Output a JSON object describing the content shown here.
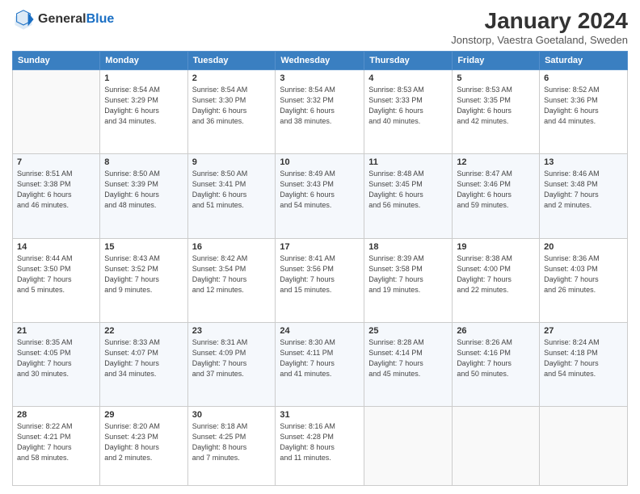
{
  "header": {
    "logo_general": "General",
    "logo_blue": "Blue",
    "month_title": "January 2024",
    "location": "Jonstorp, Vaestra Goetaland, Sweden"
  },
  "weekdays": [
    "Sunday",
    "Monday",
    "Tuesday",
    "Wednesday",
    "Thursday",
    "Friday",
    "Saturday"
  ],
  "weeks": [
    [
      {
        "day": "",
        "info": ""
      },
      {
        "day": "1",
        "info": "Sunrise: 8:54 AM\nSunset: 3:29 PM\nDaylight: 6 hours\nand 34 minutes."
      },
      {
        "day": "2",
        "info": "Sunrise: 8:54 AM\nSunset: 3:30 PM\nDaylight: 6 hours\nand 36 minutes."
      },
      {
        "day": "3",
        "info": "Sunrise: 8:54 AM\nSunset: 3:32 PM\nDaylight: 6 hours\nand 38 minutes."
      },
      {
        "day": "4",
        "info": "Sunrise: 8:53 AM\nSunset: 3:33 PM\nDaylight: 6 hours\nand 40 minutes."
      },
      {
        "day": "5",
        "info": "Sunrise: 8:53 AM\nSunset: 3:35 PM\nDaylight: 6 hours\nand 42 minutes."
      },
      {
        "day": "6",
        "info": "Sunrise: 8:52 AM\nSunset: 3:36 PM\nDaylight: 6 hours\nand 44 minutes."
      }
    ],
    [
      {
        "day": "7",
        "info": "Sunrise: 8:51 AM\nSunset: 3:38 PM\nDaylight: 6 hours\nand 46 minutes."
      },
      {
        "day": "8",
        "info": "Sunrise: 8:50 AM\nSunset: 3:39 PM\nDaylight: 6 hours\nand 48 minutes."
      },
      {
        "day": "9",
        "info": "Sunrise: 8:50 AM\nSunset: 3:41 PM\nDaylight: 6 hours\nand 51 minutes."
      },
      {
        "day": "10",
        "info": "Sunrise: 8:49 AM\nSunset: 3:43 PM\nDaylight: 6 hours\nand 54 minutes."
      },
      {
        "day": "11",
        "info": "Sunrise: 8:48 AM\nSunset: 3:45 PM\nDaylight: 6 hours\nand 56 minutes."
      },
      {
        "day": "12",
        "info": "Sunrise: 8:47 AM\nSunset: 3:46 PM\nDaylight: 6 hours\nand 59 minutes."
      },
      {
        "day": "13",
        "info": "Sunrise: 8:46 AM\nSunset: 3:48 PM\nDaylight: 7 hours\nand 2 minutes."
      }
    ],
    [
      {
        "day": "14",
        "info": "Sunrise: 8:44 AM\nSunset: 3:50 PM\nDaylight: 7 hours\nand 5 minutes."
      },
      {
        "day": "15",
        "info": "Sunrise: 8:43 AM\nSunset: 3:52 PM\nDaylight: 7 hours\nand 9 minutes."
      },
      {
        "day": "16",
        "info": "Sunrise: 8:42 AM\nSunset: 3:54 PM\nDaylight: 7 hours\nand 12 minutes."
      },
      {
        "day": "17",
        "info": "Sunrise: 8:41 AM\nSunset: 3:56 PM\nDaylight: 7 hours\nand 15 minutes."
      },
      {
        "day": "18",
        "info": "Sunrise: 8:39 AM\nSunset: 3:58 PM\nDaylight: 7 hours\nand 19 minutes."
      },
      {
        "day": "19",
        "info": "Sunrise: 8:38 AM\nSunset: 4:00 PM\nDaylight: 7 hours\nand 22 minutes."
      },
      {
        "day": "20",
        "info": "Sunrise: 8:36 AM\nSunset: 4:03 PM\nDaylight: 7 hours\nand 26 minutes."
      }
    ],
    [
      {
        "day": "21",
        "info": "Sunrise: 8:35 AM\nSunset: 4:05 PM\nDaylight: 7 hours\nand 30 minutes."
      },
      {
        "day": "22",
        "info": "Sunrise: 8:33 AM\nSunset: 4:07 PM\nDaylight: 7 hours\nand 34 minutes."
      },
      {
        "day": "23",
        "info": "Sunrise: 8:31 AM\nSunset: 4:09 PM\nDaylight: 7 hours\nand 37 minutes."
      },
      {
        "day": "24",
        "info": "Sunrise: 8:30 AM\nSunset: 4:11 PM\nDaylight: 7 hours\nand 41 minutes."
      },
      {
        "day": "25",
        "info": "Sunrise: 8:28 AM\nSunset: 4:14 PM\nDaylight: 7 hours\nand 45 minutes."
      },
      {
        "day": "26",
        "info": "Sunrise: 8:26 AM\nSunset: 4:16 PM\nDaylight: 7 hours\nand 50 minutes."
      },
      {
        "day": "27",
        "info": "Sunrise: 8:24 AM\nSunset: 4:18 PM\nDaylight: 7 hours\nand 54 minutes."
      }
    ],
    [
      {
        "day": "28",
        "info": "Sunrise: 8:22 AM\nSunset: 4:21 PM\nDaylight: 7 hours\nand 58 minutes."
      },
      {
        "day": "29",
        "info": "Sunrise: 8:20 AM\nSunset: 4:23 PM\nDaylight: 8 hours\nand 2 minutes."
      },
      {
        "day": "30",
        "info": "Sunrise: 8:18 AM\nSunset: 4:25 PM\nDaylight: 8 hours\nand 7 minutes."
      },
      {
        "day": "31",
        "info": "Sunrise: 8:16 AM\nSunset: 4:28 PM\nDaylight: 8 hours\nand 11 minutes."
      },
      {
        "day": "",
        "info": ""
      },
      {
        "day": "",
        "info": ""
      },
      {
        "day": "",
        "info": ""
      }
    ]
  ]
}
